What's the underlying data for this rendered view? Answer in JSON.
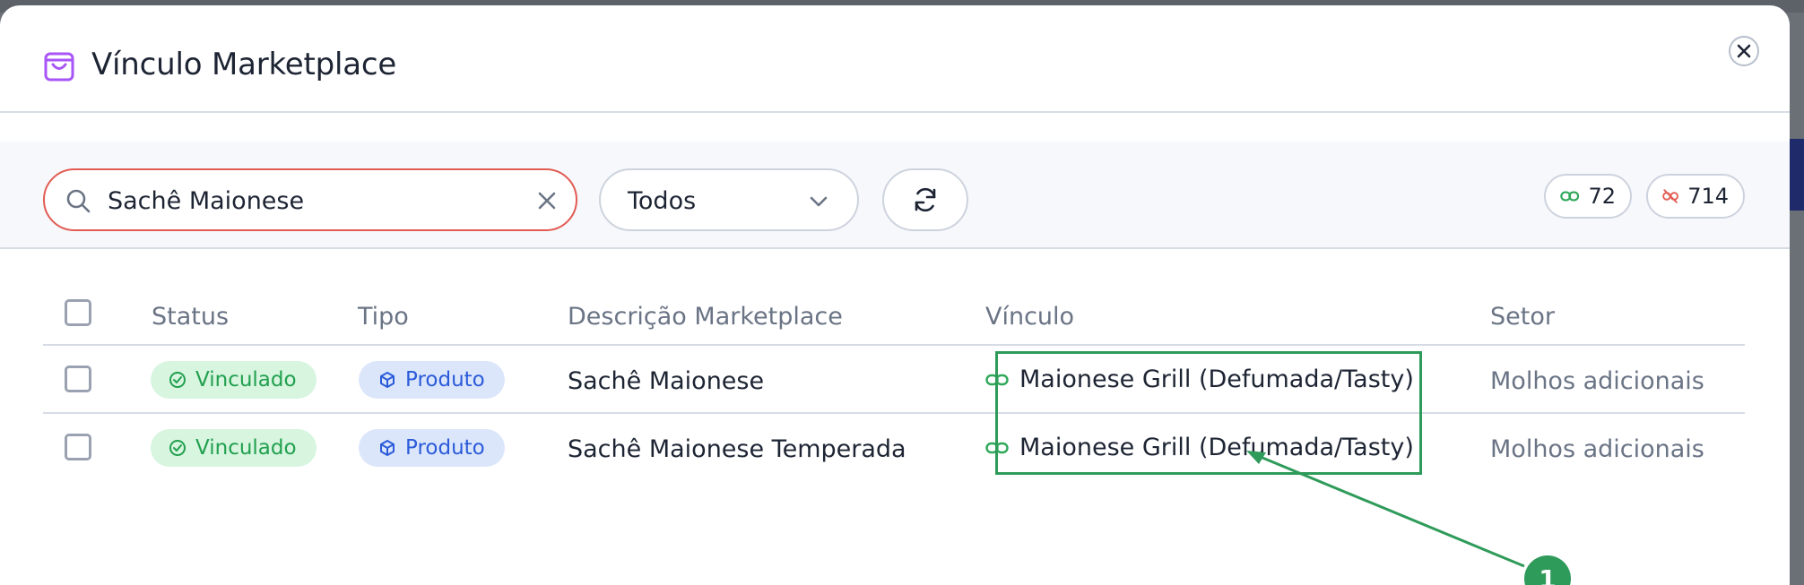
{
  "modal": {
    "title": "Vínculo Marketplace",
    "close_icon": "close-icon",
    "accent_color": "#a855f7"
  },
  "toolbar": {
    "search_value": "Sachê Maionese",
    "filter_selected": "Todos",
    "linked_count": "72",
    "unlinked_count": "714"
  },
  "table": {
    "headers": {
      "status": "Status",
      "tipo": "Tipo",
      "descricao": "Descrição Marketplace",
      "vinculo": "Vínculo",
      "setor": "Setor"
    },
    "rows": [
      {
        "status": "Vinculado",
        "tipo": "Produto",
        "descricao": "Sachê Maionese",
        "vinculo": "Maionese Grill (Defumada/Tasty)",
        "setor": "Molhos adicionais"
      },
      {
        "status": "Vinculado",
        "tipo": "Produto",
        "descricao": "Sachê Maionese Temperada",
        "vinculo": "Maionese Grill (Defumada/Tasty)",
        "setor": "Molhos adicionais"
      }
    ]
  },
  "annotation": {
    "marker_label": "1",
    "color": "#2f9b5a"
  },
  "colors": {
    "status_green": "#22a04f",
    "type_blue": "#2b5bd9",
    "search_border": "#e25b53"
  }
}
